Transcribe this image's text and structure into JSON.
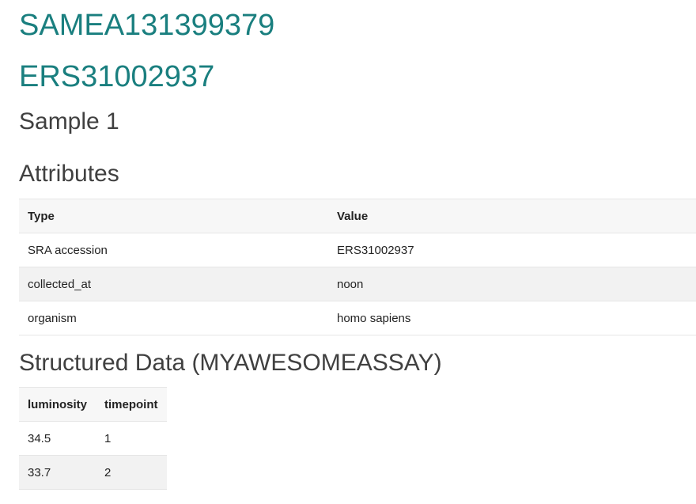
{
  "header": {
    "sample_accession": "SAMEA131399379",
    "sra_accession": "ERS31002937",
    "sample_name": "Sample 1"
  },
  "attributes": {
    "heading": "Attributes",
    "columns": [
      "Type",
      "Value"
    ],
    "rows": [
      {
        "type": "SRA accession",
        "value": "ERS31002937"
      },
      {
        "type": "collected_at",
        "value": "noon"
      },
      {
        "type": "organism",
        "value": "homo sapiens"
      }
    ]
  },
  "structured_data": {
    "heading": "Structured Data (MYAWESOMEASSAY)",
    "columns": [
      "luminosity",
      "timepoint"
    ],
    "rows": [
      {
        "luminosity": "34.5",
        "timepoint": "1"
      },
      {
        "luminosity": "33.7",
        "timepoint": "2"
      }
    ]
  }
}
